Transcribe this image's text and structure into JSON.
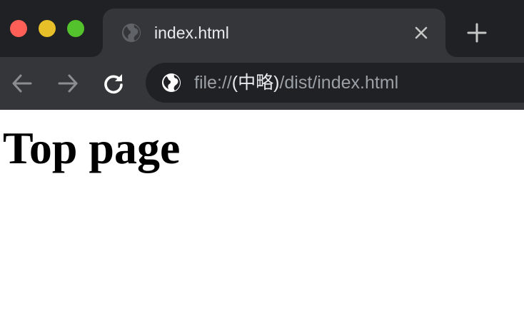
{
  "window": {
    "controls": {
      "close_color": "#ff5f57",
      "minimize_color": "#e6bf29",
      "zoom_color": "#54c22d"
    }
  },
  "tab": {
    "title": "index.html",
    "favicon": "globe-icon",
    "close_icon": "close-icon"
  },
  "tabstrip": {
    "new_tab_icon": "plus-icon"
  },
  "toolbar": {
    "back_icon": "arrow-left-icon",
    "forward_icon": "arrow-right-icon",
    "reload_icon": "reload-icon"
  },
  "address_bar": {
    "icon": "globe-icon",
    "url_prefix": "file://",
    "url_highlight": "(中略)",
    "url_suffix": "/dist/index.html"
  },
  "page": {
    "heading": "Top page"
  },
  "colors": {
    "tabstrip_bg": "#202124",
    "tab_bg": "#35363a",
    "omnibox_bg": "#202124",
    "text_light": "#e8eaed",
    "text_dim": "#9aa0a6"
  }
}
